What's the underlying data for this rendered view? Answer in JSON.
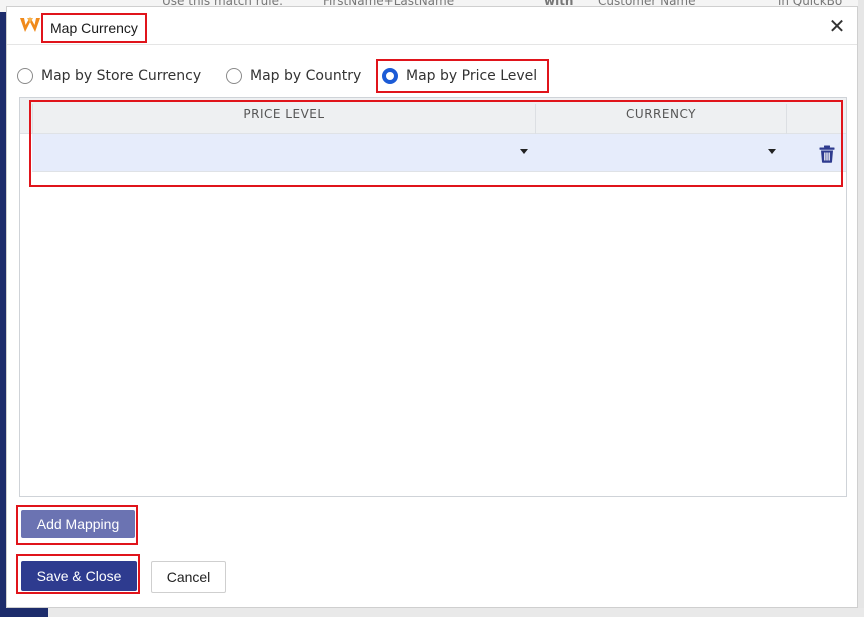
{
  "background": {
    "strip_texts": [
      "Use this match rule:",
      "FirstName+LastName",
      "with",
      "Customer Name",
      "in QuickBo"
    ]
  },
  "dialog": {
    "title": "Map Currency",
    "close_glyph": "✕",
    "logo_icon": "app-logo-icon"
  },
  "options": {
    "items": [
      {
        "label": "Map by Store Currency",
        "checked": false
      },
      {
        "label": "Map by Country",
        "checked": false
      },
      {
        "label": "Map by Price Level",
        "checked": true
      }
    ]
  },
  "grid": {
    "columns": [
      "PRICE LEVEL",
      "CURRENCY"
    ],
    "rows": [
      {
        "price_level": "",
        "currency": "",
        "delete_icon": "trash-icon"
      }
    ]
  },
  "buttons": {
    "add_mapping": "Add Mapping",
    "save_close": "Save & Close",
    "cancel": "Cancel"
  },
  "colors": {
    "accent": "#2e3b8f",
    "add_button": "#6b73b2",
    "radio_checked": "#1c5bd6",
    "row_highlight": "#e6ecfb",
    "annotation_red": "#e0141b",
    "logo": "#f08a1c"
  }
}
